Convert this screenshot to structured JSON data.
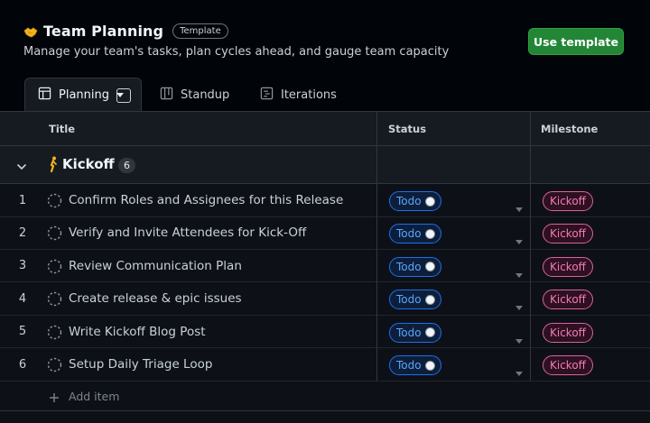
{
  "header": {
    "title": "Team Planning",
    "badge": "Template",
    "subtitle": "Manage your team's tasks, plan cycles ahead, and gauge team capacity",
    "use_template_label": "Use template"
  },
  "tabs": [
    {
      "label": "Planning",
      "icon": "table-icon",
      "active": true
    },
    {
      "label": "Standup",
      "icon": "board-icon",
      "active": false
    },
    {
      "label": "Iterations",
      "icon": "roadmap-icon",
      "active": false
    }
  ],
  "columns": {
    "title": "Title",
    "status": "Status",
    "milestone": "Milestone"
  },
  "group": {
    "name": "Kickoff",
    "count": "6"
  },
  "rows": [
    {
      "num": "1",
      "title": "Confirm Roles and Assignees for this Release",
      "status": "Todo",
      "milestone": "Kickoff"
    },
    {
      "num": "2",
      "title": "Verify and Invite Attendees for Kick-Off",
      "status": "Todo",
      "milestone": "Kickoff"
    },
    {
      "num": "3",
      "title": "Review Communication Plan",
      "status": "Todo",
      "milestone": "Kickoff"
    },
    {
      "num": "4",
      "title": "Create release & epic issues",
      "status": "Todo",
      "milestone": "Kickoff"
    },
    {
      "num": "5",
      "title": "Write Kickoff Blog Post",
      "status": "Todo",
      "milestone": "Kickoff"
    },
    {
      "num": "6",
      "title": "Setup Daily Triage Loop",
      "status": "Todo",
      "milestone": "Kickoff"
    }
  ],
  "add_item_label": "Add item",
  "colors": {
    "primary_button": "#238636",
    "status_todo": "#58a6ff",
    "milestone": "#f778ba",
    "background": "#0d1117"
  }
}
